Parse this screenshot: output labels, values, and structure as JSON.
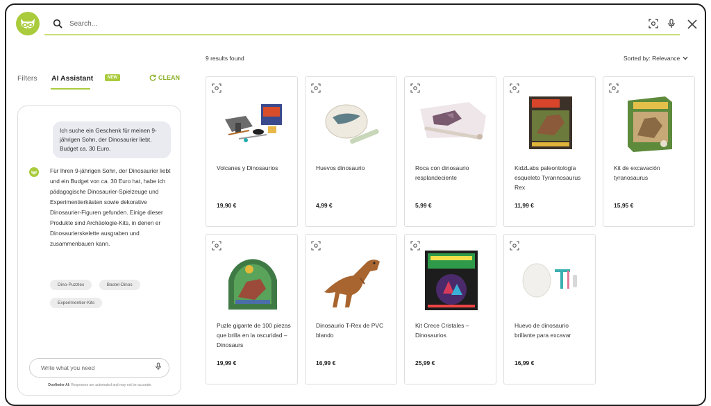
{
  "header": {
    "search_placeholder": "Search...",
    "icons": [
      "search-icon",
      "visual-search-icon",
      "microphone-icon",
      "close-icon"
    ],
    "accent_color": "#a9cb3c"
  },
  "left_panel": {
    "tab_filters": "Filters",
    "tab_ai": "AI Assistant",
    "new_badge": "NEW",
    "clean_label": "CLEAN",
    "user_message": "Ich suche ein Geschenk für meinen 9-jährigen Sohn, der Dinosaurier liebt. Budget ca. 30 Euro.",
    "bot_message": "Für Ihren 9-jährigen Sohn, der Dinosaurier liebt und ein Budget von ca. 30 Euro hat, habe ich pädagogische Dinosaurier-Spielzeuge und Experimentierkästen sowie dekorative Dinosaurier-Figuren gefunden. Einige dieser Produkte sind Archäologie-Kits, in denen er Dinosaurierskelette ausgraben und zusammenbauen kann.",
    "chips": [
      "Dino-Puzzles",
      "Bastel-Dinos",
      "Experimentier-Kits"
    ],
    "input_placeholder": "Write what you need",
    "disclaimer_brand": "Doofinder AI:",
    "disclaimer_text": " Responses are automated and may not be accurate."
  },
  "results": {
    "count_text": "9 results found",
    "sort_label": "Sorted by: Relevance",
    "products": [
      {
        "name": "Volcanes y Dinosaurios",
        "price": "19,90 €"
      },
      {
        "name": "Huevos dinosaurio",
        "price": "4,99 €"
      },
      {
        "name": "Roca con dinosaurio resplandeciente",
        "price": "5,99 €"
      },
      {
        "name": "KidzLabs paleontología esqueleto Tyrannosaurus Rex",
        "price": "11,99 €"
      },
      {
        "name": "Kit de excavación tyranosaurus",
        "price": "15,95 €"
      },
      {
        "name": "Puzle gigante de 100 piezas que brilla en la oscuridad – Dinosaurs",
        "price": "19,99 €"
      },
      {
        "name": "Dinosaurio T-Rex de PVC blando",
        "price": "16,99 €"
      },
      {
        "name": "Kit Crece Cristales – Dinosaurios",
        "price": "25,99 €"
      },
      {
        "name": "Huevo de dinosaurio brillante para excavar",
        "price": "16,99 €"
      }
    ]
  }
}
